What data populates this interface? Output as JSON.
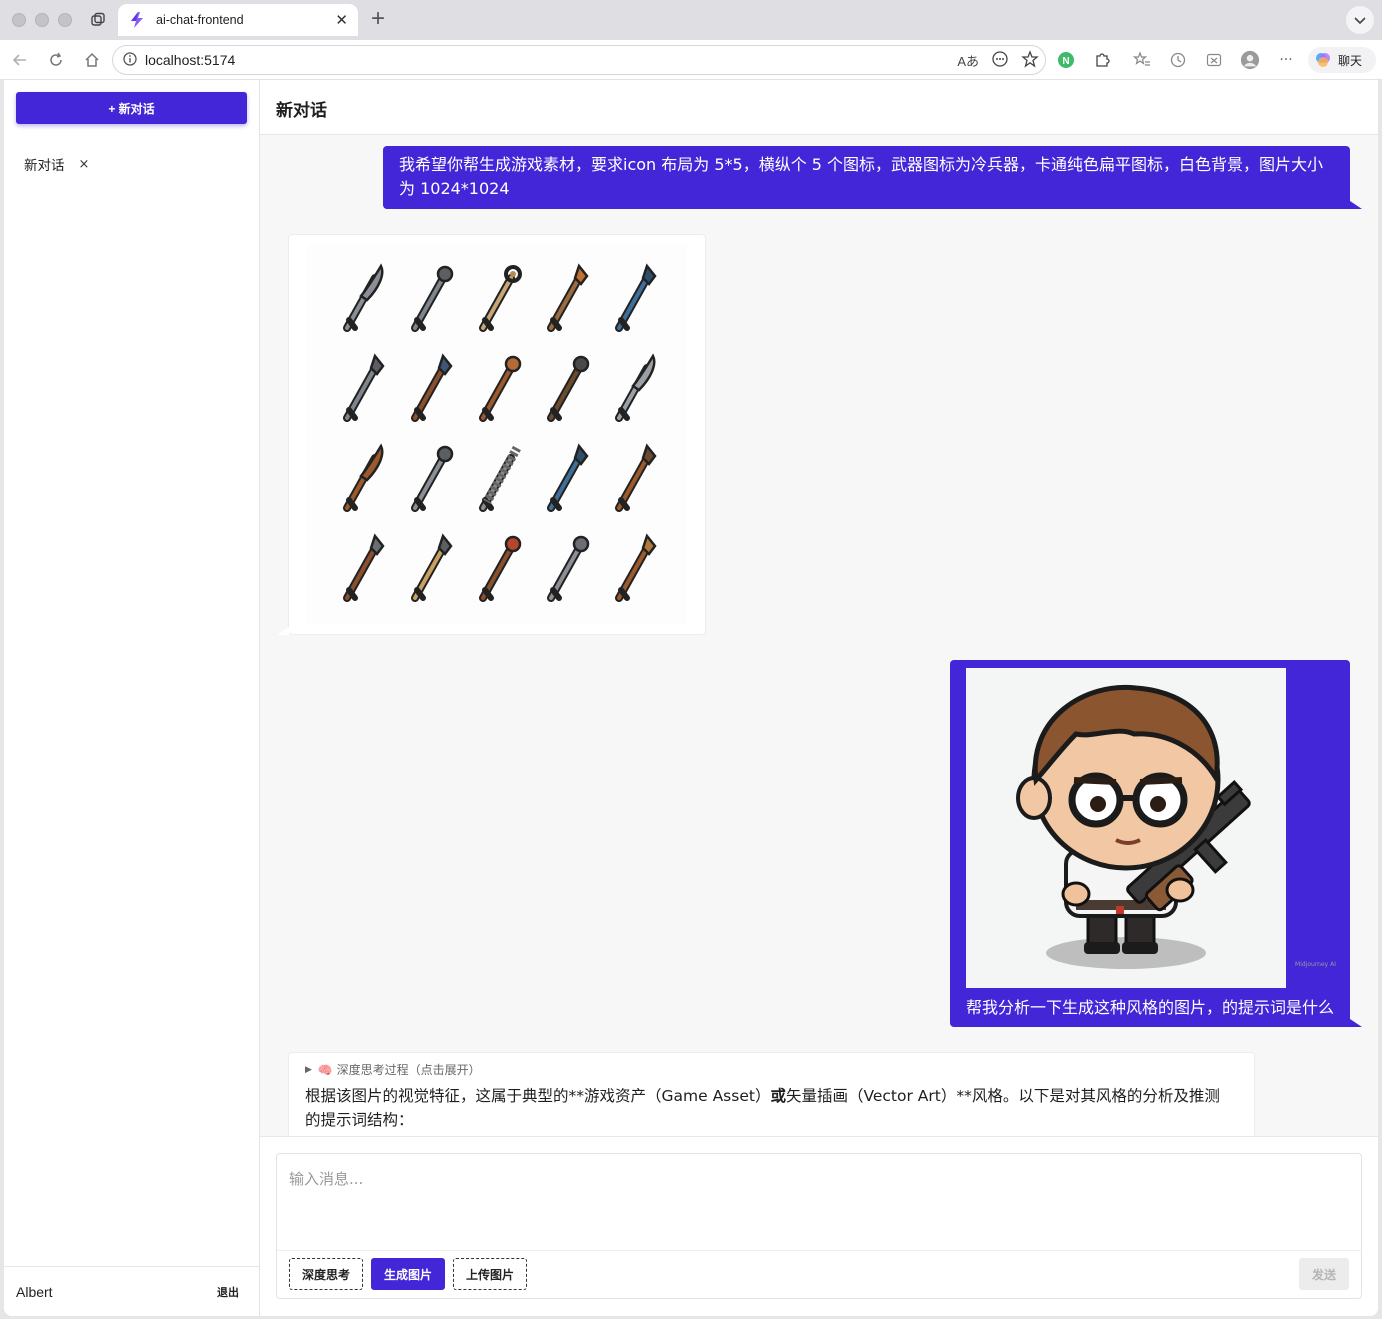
{
  "browser": {
    "tab_title": "ai-chat-frontend",
    "url": "localhost:5174",
    "chat_pill_label": "聊天",
    "brand_color": "#4326d7"
  },
  "sidebar": {
    "new_chat_label": "+ 新对话",
    "conversations": [
      {
        "title": "新对话"
      }
    ],
    "close_glyph": "×",
    "user_name": "Albert",
    "logout_label": "退出"
  },
  "chat": {
    "header_title": "新对话",
    "messages": [
      {
        "role": "user",
        "text": "我希望你帮生成游戏素材，要求icon 布局为 5*5，横纵个 5 个图标，武器图标为冷兵器，卡通纯色扁平图标，白色背景，图片大小为 1024*1024"
      },
      {
        "role": "assistant",
        "image": "weapon-icon-grid"
      },
      {
        "role": "user",
        "image": "cartoon-character-with-rifle",
        "text": "帮我分析一下生成这种风格的图片，的提示词是什么"
      },
      {
        "role": "assistant",
        "thinking_label": "🧠 深度思考过程（点击展开）",
        "answer_lines": [
          "根据该图片的视觉特征，这属于典型的**游戏资产（Game Asset）",
          "或",
          "矢量插画（Vector Art）**风格。以下是对其风格的分析及推测",
          "的提示词结构："
        ]
      }
    ]
  },
  "composer": {
    "placeholder": "输入消息...",
    "buttons": {
      "deep_think": "深度思考",
      "generate_image": "生成图片",
      "upload_image": "上传图片",
      "send": "发送"
    }
  },
  "watermark_text": "Midjourney AI"
}
